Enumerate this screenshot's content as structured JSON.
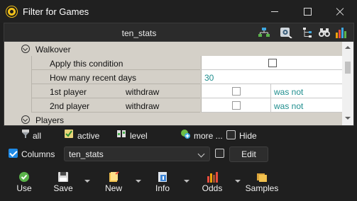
{
  "window": {
    "title": "Filter for Games"
  },
  "panel": {
    "title": "ten_stats"
  },
  "grid": {
    "group1": "Walkover",
    "apply_condition": "Apply this condition",
    "recent_days_label": "How many recent days",
    "recent_days_value": "30",
    "player1_label": "1st player",
    "player1_type": "withdraw",
    "player1_state": "was not",
    "player2_label": "2nd player",
    "player2_type": "withdraw",
    "player2_state": "was not",
    "group2": "Players"
  },
  "subbar": {
    "all": "all",
    "active": "active",
    "level": "level",
    "more": "more ...",
    "hide": "Hide"
  },
  "columns": {
    "label": "Columns",
    "checked": true,
    "selected": "ten_stats",
    "edit": "Edit"
  },
  "toolbar": {
    "use": "Use",
    "save": "Save",
    "new": "New",
    "info": "Info",
    "odds": "Odds",
    "samples": "Samples"
  }
}
